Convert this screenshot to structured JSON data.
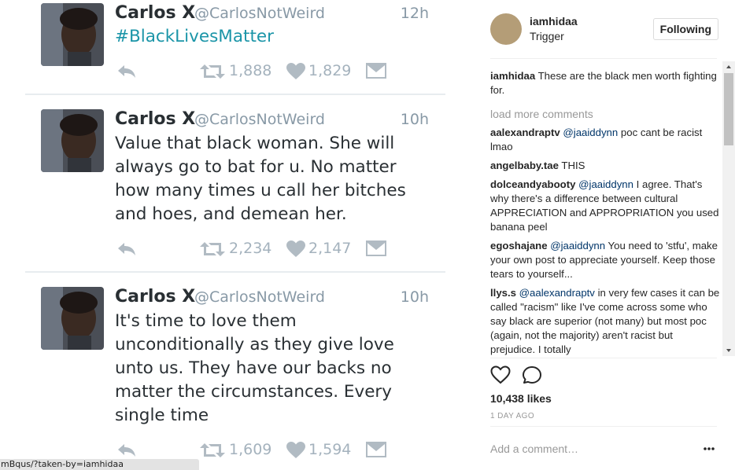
{
  "tweets": [
    {
      "name": "Carlos X",
      "handle": "@CarlosNotWeird",
      "time": "12h",
      "lines": [
        "#BlackLivesMatter"
      ],
      "retweets": "1,888",
      "likes": "1,829"
    },
    {
      "name": "Carlos X",
      "handle": "@CarlosNotWeird",
      "time": "10h",
      "lines": [
        "Value that black woman. She will",
        "always go to bat for u. No matter",
        "how many times u call her bitches",
        "and hoes, and demean her."
      ],
      "retweets": "2,234",
      "likes": "2,147"
    },
    {
      "name": "Carlos X",
      "handle": "@CarlosNotWeird",
      "time": "10h",
      "lines": [
        "It's time to love them",
        "unconditionally as they give love",
        "unto us. They have our backs no",
        "matter the circumstances. Every",
        "single time"
      ],
      "retweets": "1,609",
      "likes": "1,594"
    }
  ],
  "status_url": "mBqus/?taken-by=iamhidaa",
  "post": {
    "owner": "iamhidaa",
    "location": "Trigger",
    "follow_label": "Following",
    "caption_user": "iamhidaa",
    "caption_text": "These are the black men worth fighting for.",
    "load_more": "load more comments",
    "comments": [
      {
        "user": "aalexandraptv",
        "mention": "@jaaiddynn",
        "text": "poc cant be racist lmao"
      },
      {
        "user": "angelbaby.tae",
        "mention": "",
        "text": "THIS"
      },
      {
        "user": "dolceandyabooty",
        "mention": "@jaaiddynn",
        "text": "I agree. That's why there's a difference between cultural APPRECIATION and APPROPRIATION you used banana peel"
      },
      {
        "user": "egoshajane",
        "mention": "@jaaiddynn",
        "text": "You need to 'stfu', make your own post to appreciate yourself. Keep those tears to yourself..."
      },
      {
        "user": "llys.s",
        "mention": "@aalexandraptv",
        "text": "in very few cases it can be called \"racism\" like I've come across some who say black are superior (not many) but most poc (again, not the majority) aren't racist but prejudice. I totally"
      }
    ],
    "likes": "10,438 likes",
    "time": "1 DAY AGO",
    "comment_placeholder": "Add a comment…",
    "more_icon": "ellipsis-icon"
  },
  "colors": {
    "hashtag": "#1b95a8",
    "mention": "#003569",
    "muted": "#999999"
  }
}
